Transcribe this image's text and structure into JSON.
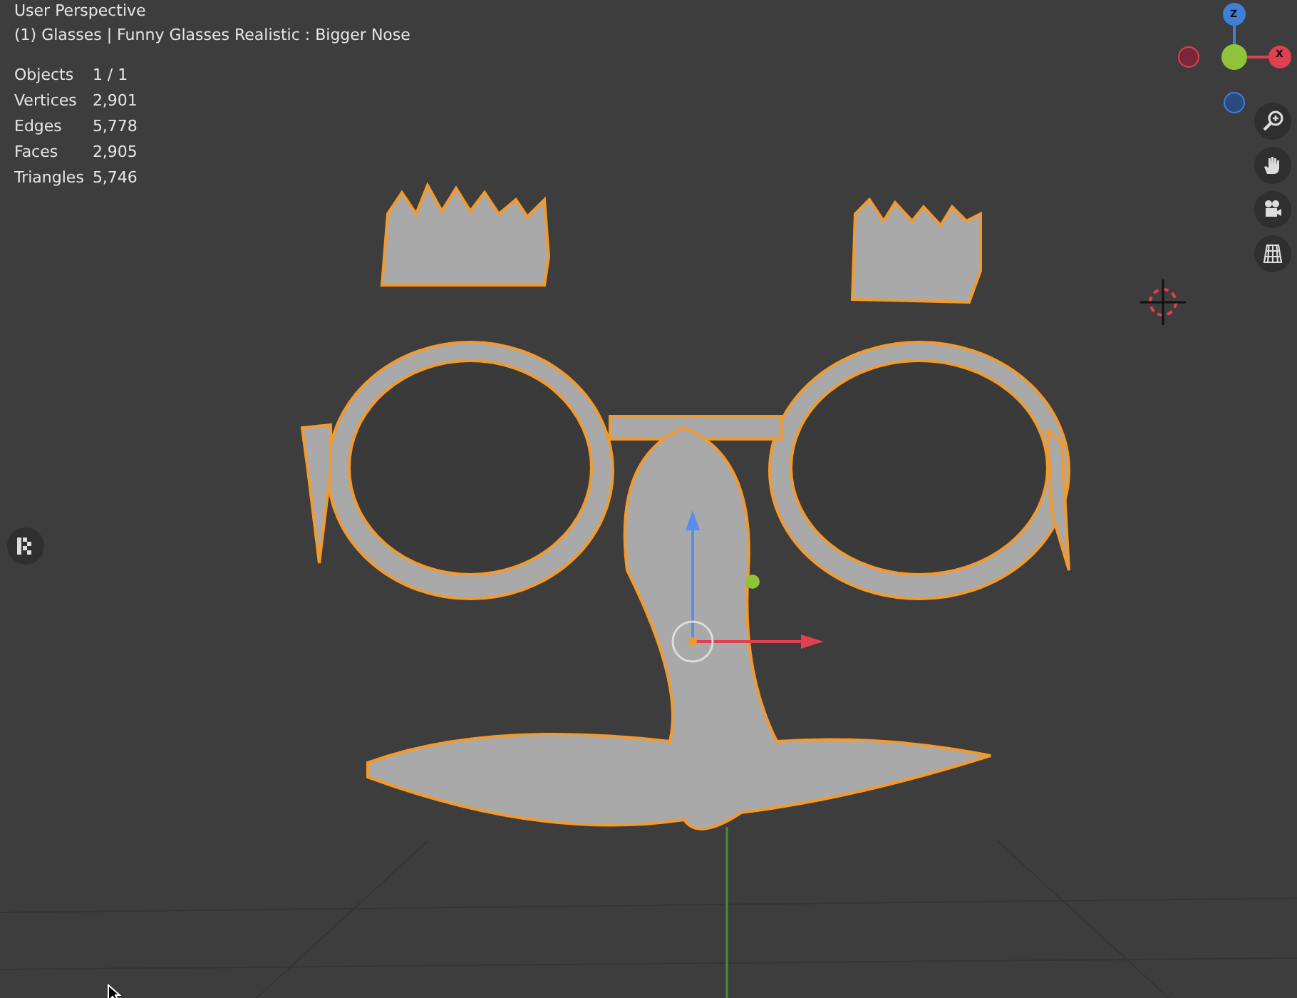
{
  "viewport": {
    "view_name": "User Perspective",
    "object_info": "(1) Glasses | Funny Glasses Realistic : Bigger Nose",
    "stats": [
      {
        "label": "Objects",
        "value": "1 / 1"
      },
      {
        "label": "Vertices",
        "value": "2,901"
      },
      {
        "label": "Edges",
        "value": "5,778"
      },
      {
        "label": "Faces",
        "value": "2,905"
      },
      {
        "label": "Triangles",
        "value": "5,746"
      }
    ],
    "gizmo": {
      "z_label": "Z",
      "x_label": "X"
    },
    "nav_tools": [
      {
        "kind": "zoom"
      },
      {
        "kind": "pan"
      },
      {
        "kind": "camera"
      },
      {
        "kind": "grid"
      }
    ]
  }
}
